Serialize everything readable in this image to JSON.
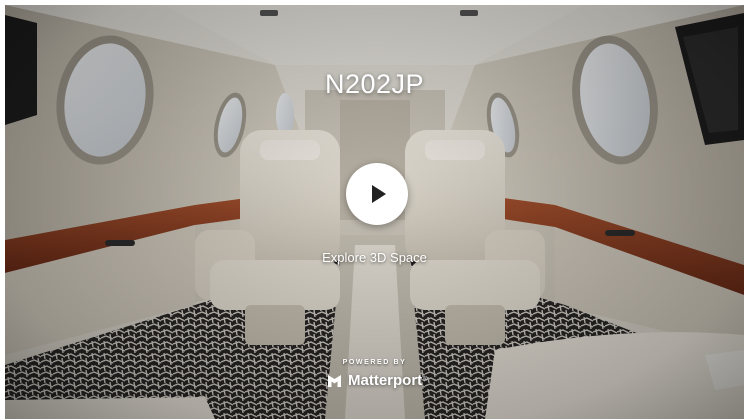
{
  "tour": {
    "title": "N202JP",
    "cta_label": "Explore 3D Space"
  },
  "branding": {
    "powered_by": "POWERED BY",
    "name": "Matterport",
    "trademark": "®"
  },
  "icons": {
    "play": "play-icon",
    "logo": "matterport-logo-icon"
  },
  "colors": {
    "leather": "#e8e2d6",
    "wood_trim": "#8a3a22",
    "cabin_wall": "#d9d3c6",
    "carpet": "#2a2626"
  }
}
